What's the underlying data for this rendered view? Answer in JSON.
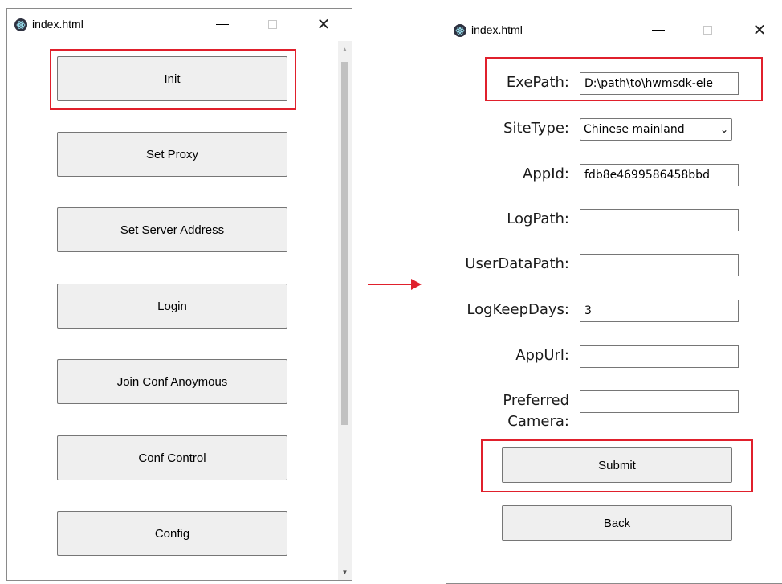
{
  "left_window": {
    "title": "index.html",
    "buttons": [
      "Init",
      "Set Proxy",
      "Set Server Address",
      "Login",
      "Join Conf Anoymous",
      "Conf Control",
      "Config"
    ]
  },
  "right_window": {
    "title": "index.html",
    "form": {
      "exe_path": {
        "label": "ExePath:",
        "value": "D:\\path\\to\\hwmsdk-ele"
      },
      "site_type": {
        "label": "SiteType:",
        "selected": "Chinese mainland"
      },
      "app_id": {
        "label": "AppId:",
        "value": "fdb8e4699586458bbd"
      },
      "log_path": {
        "label": "LogPath:",
        "value": ""
      },
      "user_data_path": {
        "label": "UserDataPath:",
        "value": ""
      },
      "log_keep_days": {
        "label": "LogKeepDays:",
        "value": "3"
      },
      "app_url": {
        "label": "AppUrl:",
        "value": ""
      },
      "preferred_camera": {
        "label_line1": "Preferred",
        "label_line2": "Camera:",
        "value": ""
      }
    },
    "submit_label": "Submit",
    "back_label": "Back"
  },
  "colors": {
    "highlight": "#e0202c",
    "button_bg": "#efefef",
    "arrow": "#e0202c"
  },
  "icons": [
    "electron-app-icon",
    "minimize-icon",
    "maximize-icon",
    "close-icon",
    "scroll-up-icon",
    "scroll-down-icon",
    "arrow-right-icon"
  ]
}
